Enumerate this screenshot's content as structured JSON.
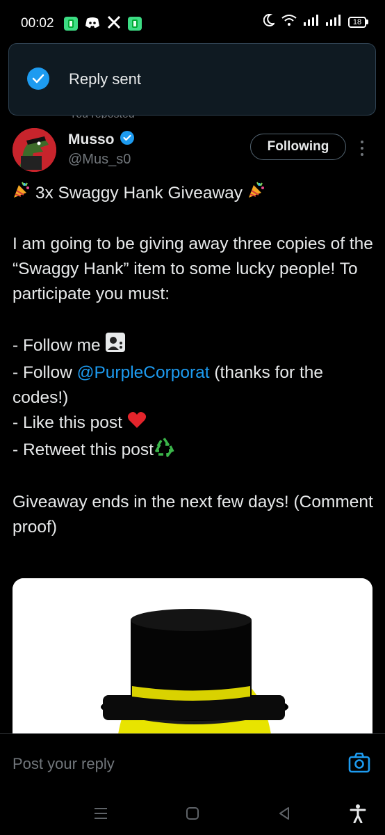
{
  "status_bar": {
    "time": "00:02",
    "battery_level": "18",
    "icons": [
      "app-notification-icon",
      "discord-icon",
      "x-icon",
      "app-notification-icon",
      "moon-icon",
      "wifi-icon",
      "signal-icon",
      "signal-icon",
      "battery-icon"
    ]
  },
  "toast": {
    "message": "Reply sent",
    "icon": "check-circle-icon",
    "accent": "#1d9bf0"
  },
  "post": {
    "reposted_label": "You reposted",
    "author_name": "Musso",
    "verified": true,
    "handle": "@Mus_s0",
    "follow_label": "Following",
    "title": "3x Swaggy Hank Giveaway",
    "paragraph1": "I am going to be giving away three copies of the “Swaggy Hank” item to some lucky people! To participate you must:",
    "list": {
      "item1": "- Follow me",
      "item2_prefix": "- Follow ",
      "item2_mention": "@PurpleCorporat",
      "item2_suffix": " (thanks for the codes!)",
      "item3": "- Like this post",
      "item4": "- Retweet this post"
    },
    "closing": "Giveaway ends in the next few days! (Comment proof)",
    "media_alt": "Yellow character with a black top hat"
  },
  "reply": {
    "placeholder": "Post your reply",
    "camera_icon": "camera-icon"
  },
  "nav": {
    "buttons": [
      "menu-icon",
      "home-icon",
      "back-icon",
      "accessibility-icon"
    ]
  },
  "colors": {
    "background": "#000000",
    "accent": "#1d9bf0",
    "text": "#e7e9ea",
    "muted": "#71767b"
  }
}
